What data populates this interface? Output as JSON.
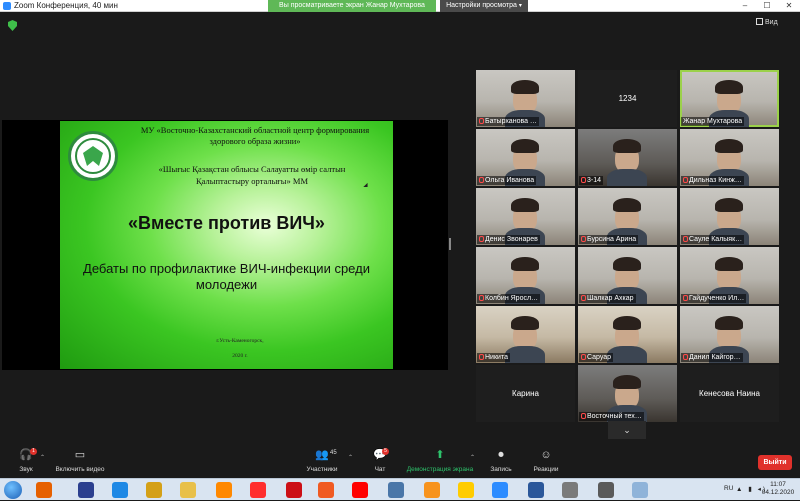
{
  "window": {
    "title": "Zoom Конференция, 40 мин",
    "share_banner": "Вы просматриваете экран Жанар Мухтарова",
    "view_options": "Настройки просмотра",
    "view_options_caret": "▾",
    "controls": {
      "minimize": "–",
      "maximize": "☐",
      "close": "✕"
    }
  },
  "meeting": {
    "view_label": "Вид"
  },
  "slide": {
    "org_ru": "МУ «Восточно-Казахстанский областной центр формирования здорового образа жизни»",
    "org_kz": "«Шығыс Қазақстан облысы Салауатты өмір салтын Қалыптастыру орталығы» ММ",
    "headline": "«Вместе против ВИЧ»",
    "subtitle": "Дебаты по профилактике ВИЧ-инфекции среди молодежи",
    "city": "г.Усть-Каменогорск,",
    "year": "2020 г."
  },
  "gallery": {
    "tiles": [
      {
        "name": "Батырханова …",
        "muted": true,
        "video": true,
        "style": "cam"
      },
      {
        "name": "1234",
        "muted": false,
        "video": false,
        "style": "blank"
      },
      {
        "name": "Жанар Мухтарова",
        "muted": false,
        "video": true,
        "style": "cam",
        "active": true
      },
      {
        "name": "Ольга Иванова",
        "muted": true,
        "video": true,
        "style": "cam"
      },
      {
        "name": "3-14",
        "muted": true,
        "video": true,
        "style": "cam dark"
      },
      {
        "name": "Дильназ Кинж…",
        "muted": true,
        "video": true,
        "style": "cam"
      },
      {
        "name": "Денис Звонарев",
        "muted": true,
        "video": true,
        "style": "cam"
      },
      {
        "name": "Бурсина Арина",
        "muted": true,
        "video": true,
        "style": "cam"
      },
      {
        "name": "Сауле Калыяк…",
        "muted": true,
        "video": true,
        "style": "cam"
      },
      {
        "name": "Колбин Яросл…",
        "muted": true,
        "video": true,
        "style": "cam"
      },
      {
        "name": "Шалкар Ахкар",
        "muted": true,
        "video": true,
        "style": "cam"
      },
      {
        "name": "Гайдученко Ил…",
        "muted": true,
        "video": true,
        "style": "cam"
      },
      {
        "name": "Никита",
        "muted": true,
        "video": true,
        "style": "cam warm"
      },
      {
        "name": "Саруар",
        "muted": true,
        "video": true,
        "style": "cam warm"
      },
      {
        "name": "Данил Кайгор…",
        "muted": true,
        "video": true,
        "style": "cam"
      },
      {
        "name": "Карина",
        "muted": false,
        "video": false,
        "style": "blank"
      },
      {
        "name": "Восточный тех…",
        "muted": true,
        "video": true,
        "style": "cam dark"
      },
      {
        "name": "Кенесова Наина",
        "muted": false,
        "video": false,
        "style": "blank"
      }
    ],
    "scroll_glyph": "⌄"
  },
  "toolbar": {
    "audio": {
      "label": "Звук",
      "glyph": "🎧",
      "badge": "1"
    },
    "video": {
      "label": "Включить видео",
      "glyph": "▭"
    },
    "participants": {
      "label": "Участники",
      "glyph": "👥",
      "count": "45"
    },
    "chat": {
      "label": "Чат",
      "glyph": "💬",
      "badge": "5"
    },
    "share": {
      "label": "Демонстрация экрана",
      "glyph": "⬆"
    },
    "record": {
      "label": "Запись",
      "glyph": "⏺"
    },
    "reactions": {
      "label": "Реакции",
      "glyph": "☺"
    },
    "leave": "Выйти",
    "caret": "⌃",
    "colors": {
      "share_green": "#2dc26b",
      "leave_red": "#e0312b"
    }
  },
  "taskbar": {
    "apps": [
      {
        "icon": "firefox-icon",
        "color": "#e66000"
      },
      {
        "icon": "floppy-icon",
        "color": "#2b3f8f"
      },
      {
        "icon": "ie-icon",
        "color": "#1e88e5"
      },
      {
        "icon": "paint-icon",
        "color": "#d4a017"
      },
      {
        "icon": "folder-icon",
        "color": "#e8c04a"
      },
      {
        "icon": "vlc-icon",
        "color": "#ff8800"
      },
      {
        "icon": "yandex-icon",
        "color": "#ff2d2d"
      },
      {
        "icon": "opera-icon",
        "color": "#cc0f16"
      },
      {
        "icon": "edge-icon",
        "color": "#f05a22"
      },
      {
        "icon": "youtube-icon",
        "color": "#ff0000"
      },
      {
        "icon": "vk-icon",
        "color": "#4a76a8"
      },
      {
        "icon": "ok-icon",
        "color": "#f7931e"
      },
      {
        "icon": "yandex-browser-icon",
        "color": "#ffcc00"
      },
      {
        "icon": "zoom-icon",
        "color": "#2d8cff"
      },
      {
        "icon": "word-icon",
        "color": "#2b579a"
      },
      {
        "icon": "unknown-app-icon",
        "color": "#7a7a7a"
      },
      {
        "icon": "media-icon",
        "color": "#5a5a5a"
      },
      {
        "icon": "explorer-icon",
        "color": "#8fb3d9"
      }
    ],
    "lang": "RU",
    "time": "11:07",
    "date": "04.12.2020"
  }
}
